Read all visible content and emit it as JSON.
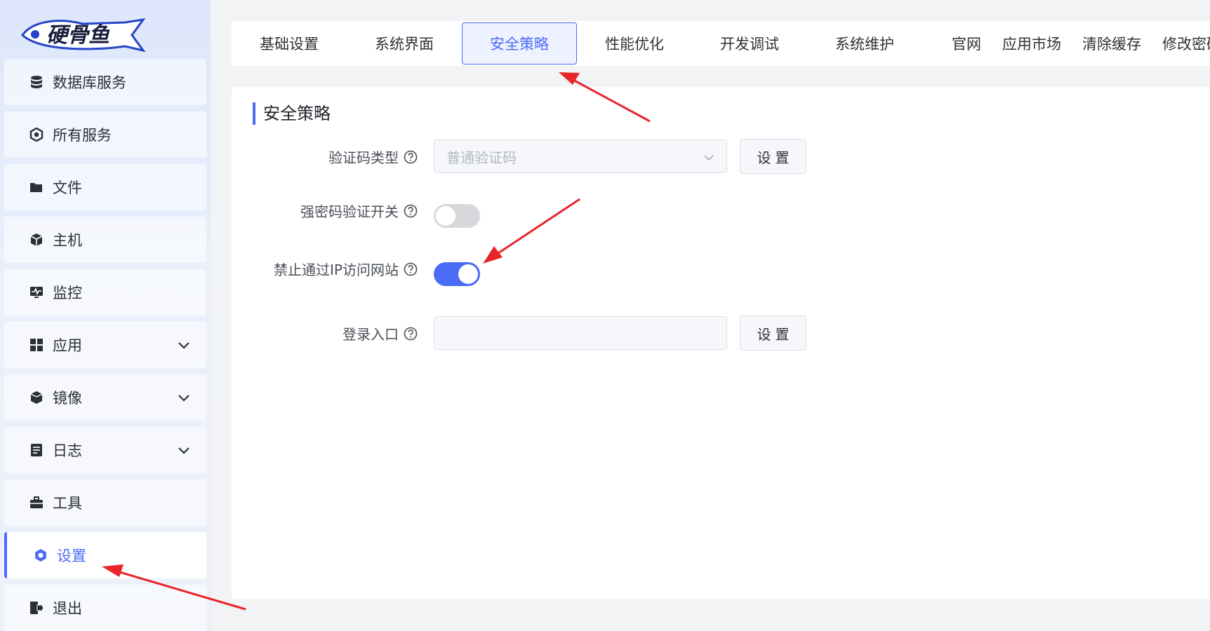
{
  "brand": {
    "logo_text": "硬骨鱼"
  },
  "sidebar": {
    "items": [
      {
        "label": "数据库服务",
        "icon": "database-icon",
        "expandable": false
      },
      {
        "label": "所有服务",
        "icon": "services-icon",
        "expandable": false
      },
      {
        "label": "文件",
        "icon": "folder-icon",
        "expandable": false
      },
      {
        "label": "主机",
        "icon": "host-icon",
        "expandable": false
      },
      {
        "label": "监控",
        "icon": "monitor-icon",
        "expandable": false
      },
      {
        "label": "应用",
        "icon": "apps-grid-icon",
        "expandable": true
      },
      {
        "label": "镜像",
        "icon": "image-cube-icon",
        "expandable": true
      },
      {
        "label": "日志",
        "icon": "log-icon",
        "expandable": true
      },
      {
        "label": "工具",
        "icon": "toolbox-icon",
        "expandable": false
      },
      {
        "label": "设置",
        "icon": "gear-icon",
        "expandable": false,
        "active": true
      },
      {
        "label": "退出",
        "icon": "logout-icon",
        "expandable": false
      }
    ]
  },
  "tabs": [
    {
      "label": "基础设置"
    },
    {
      "label": "系统界面"
    },
    {
      "label": "安全策略",
      "active": true
    },
    {
      "label": "性能优化"
    },
    {
      "label": "开发调试"
    },
    {
      "label": "系统维护"
    }
  ],
  "top_links": [
    "官网",
    "应用市场",
    "清除缓存",
    "修改密码"
  ],
  "panel": {
    "title": "安全策略",
    "captcha_type": {
      "label": "验证码类型",
      "value": "普通验证码",
      "button": "设置"
    },
    "strong_password": {
      "label": "强密码验证开关",
      "enabled": false
    },
    "block_ip_access": {
      "label": "禁止通过IP访问网站",
      "enabled": true
    },
    "login_entry": {
      "label": "登录入口",
      "value": "",
      "button": "设置"
    }
  },
  "colors": {
    "accent": "#4a6cf7",
    "annotation": "#e8262a",
    "switch_off": "#d6d8dc"
  }
}
